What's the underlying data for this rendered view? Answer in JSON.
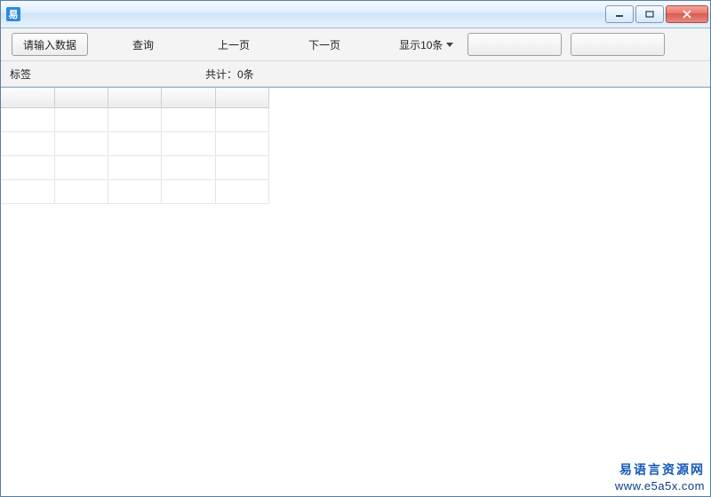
{
  "window": {
    "icon_text": "易",
    "title": ""
  },
  "toolbar": {
    "input_button": "请输入数据",
    "query": "查询",
    "prev": "上一页",
    "next": "下一页",
    "show_count": "显示10条"
  },
  "status": {
    "label": "标签",
    "total": "共计：0条"
  },
  "grid": {
    "columns": 5,
    "rows": 4
  },
  "footer": {
    "line1": "易语言资源网",
    "line2": "www.e5a5x.com"
  }
}
